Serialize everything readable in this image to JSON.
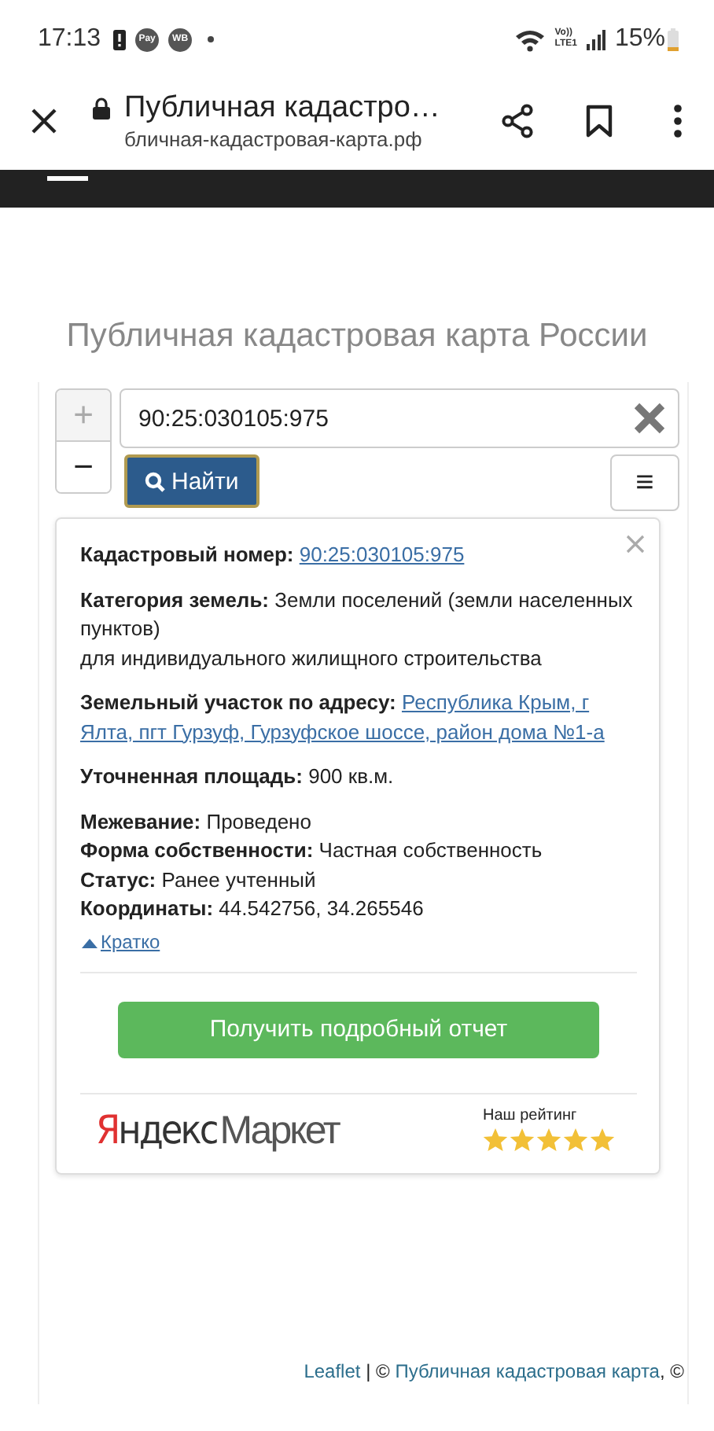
{
  "status_bar": {
    "time": "17:13",
    "notifications": [
      "Pay",
      "WB"
    ],
    "network": [
      "Vo))",
      "LTE1"
    ],
    "battery": "15%"
  },
  "browser_bar": {
    "title": "Публичная кадастро…",
    "url": "бличная-кадастровая-карта.рф"
  },
  "page_title": "Публичная кадастровая карта России",
  "map": {
    "zoom_in": "+",
    "zoom_out": "−",
    "search": {
      "value": "90:25:030105:975"
    },
    "find_button": "Найти",
    "menu_button": "≡",
    "popup": {
      "groups": [
        [
          {
            "kind": "link",
            "label": "Кадастровый номер:",
            "links": [
              "90:25:030105:975"
            ]
          }
        ],
        [
          {
            "kind": "text",
            "text": "**Категория земель:** Земли поселений (земли населенных пунктов)"
          },
          {
            "kind": "text",
            "text": "для индивидуального жилищного строительства"
          }
        ],
        [
          {
            "kind": "link",
            "label": "Земельный участок по адресу:",
            "links": [
              "Республика Крым, г",
              "Ялта, пгт Гурзуф, Гурзуфское шоссе, район дома №1-а"
            ]
          }
        ],
        [
          {
            "kind": "text",
            "text": "**Уточненная площадь:** 900 кв.м."
          }
        ],
        [
          {
            "kind": "text",
            "text": "**Межевание:** Проведено"
          },
          {
            "kind": "text",
            "text": "**Форма собственности:** Частная собственность"
          },
          {
            "kind": "text",
            "text": "**Статус:** Ранее учтенный"
          },
          {
            "kind": "text",
            "text": "**Координаты:** 44.542756, 34.265546"
          }
        ]
      ],
      "toggle": {
        "label": "Кратко",
        "expanded": true
      },
      "report_button": "Получить подробный отчет",
      "market": {
        "brand": "Яндекс",
        "name": "Маркет",
        "rating_label": "Наш рейтинг",
        "stars": 5
      }
    },
    "attribution": {
      "links": [
        "Leaflet",
        "Публичная кадастровая карта"
      ],
      "separator": "|",
      "copyright": "©",
      "tail": ", ©"
    }
  }
}
